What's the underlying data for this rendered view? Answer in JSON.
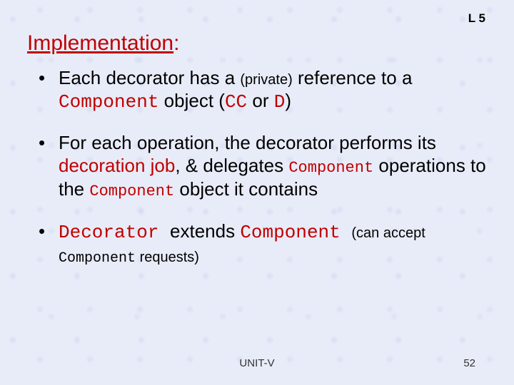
{
  "header": {
    "label": "L 5"
  },
  "title": {
    "text": "Implementation",
    "colon": ":"
  },
  "bullets": {
    "b1": {
      "t1": "Each decorator has a ",
      "priv": "(private)",
      "t2": " reference to a ",
      "comp": "Component",
      "t3": " object  (",
      "cc": "CC",
      "or": " or ",
      "d": "D",
      "close": ")"
    },
    "b2": {
      "t1": "For each operation, the decorator performs its ",
      "deco": "decoration job",
      "t2": ", & delegates ",
      "comp1": "Component",
      "t3": " operations to the ",
      "comp2": "Component",
      "t4": "  object it contains"
    },
    "b3": {
      "dec": "Decorator ",
      "ext": " extends ",
      "comp": "Component ",
      "can": " (can accept ",
      "comp2": "Component",
      "req": " requests)"
    }
  },
  "footer": {
    "center": "UNIT-V",
    "page": "52"
  }
}
